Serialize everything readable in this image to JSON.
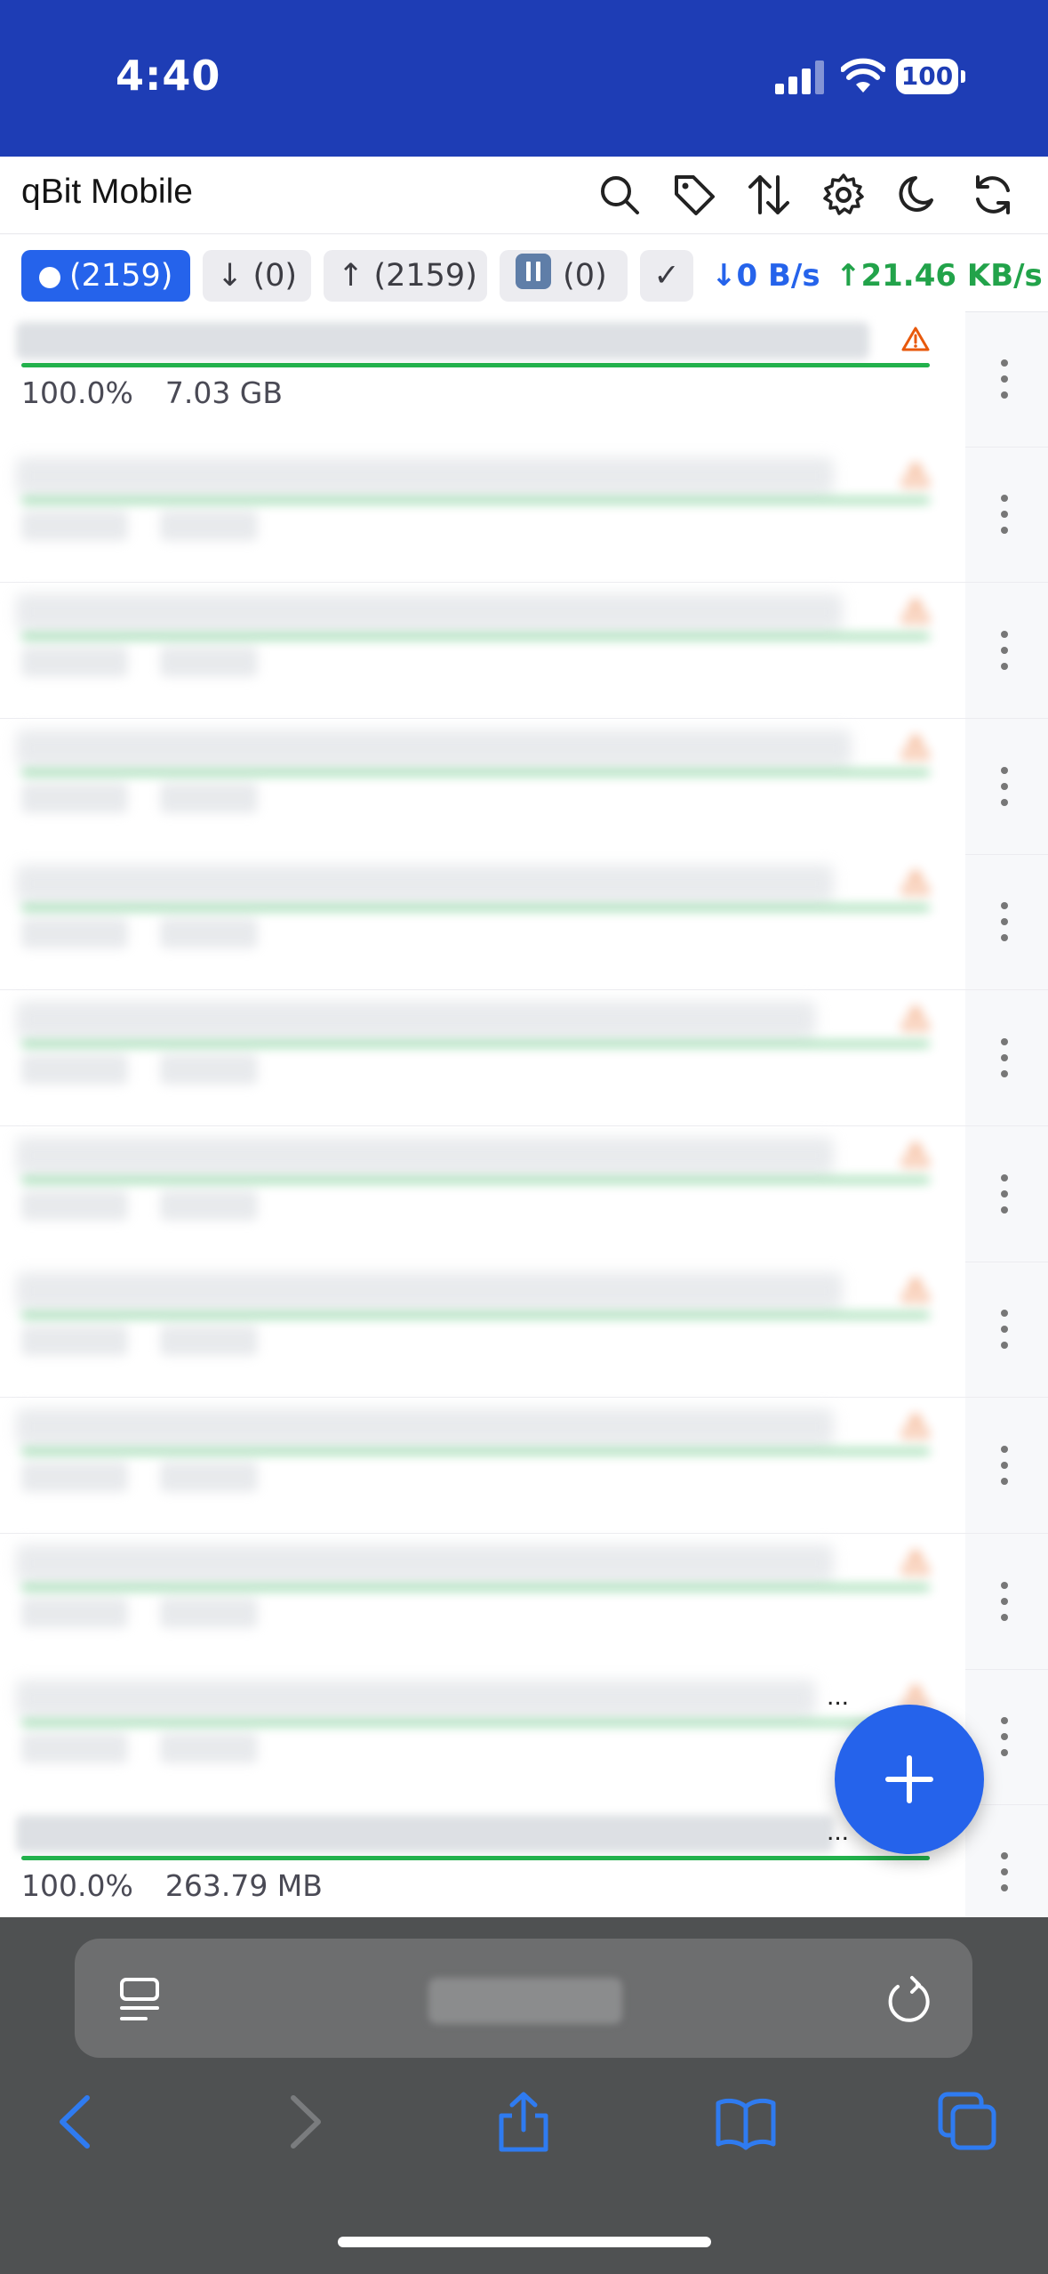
{
  "status_bar": {
    "time": "4:40",
    "battery": "100"
  },
  "app": {
    "title": "qBit Mobile"
  },
  "toolbar_icons": [
    "search-icon",
    "tag-icon",
    "sort-icon",
    "gear-icon",
    "moon-icon",
    "refresh-icon"
  ],
  "filters": {
    "all": "(2159)",
    "downloading": "(0)",
    "seeding": "(2159)",
    "paused": "(0)",
    "completed_icon": "checkmark-icon"
  },
  "speeds": {
    "download": "↓0 B/s",
    "upload": "↑21.46 KB/s",
    "download_color": "#2563eb",
    "upload_color": "#22a34a"
  },
  "torrents": [
    {
      "progress": "100.0%",
      "size": "7.03 GB",
      "progress_fraction": 1.0,
      "warning": true
    },
    {
      "blurred": true
    },
    {
      "blurred": true
    },
    {
      "blurred": true
    },
    {
      "blurred": true
    },
    {
      "blurred": true
    },
    {
      "blurred": true
    },
    {
      "blurred": true
    },
    {
      "blurred": true
    },
    {
      "blurred": true
    },
    {
      "blurred": true,
      "ellipsis": "..."
    },
    {
      "progress": "100.0%",
      "size": "263.79 MB",
      "progress_fraction": 1.0,
      "ellipsis": "..."
    }
  ],
  "colors": {
    "accent": "#2563eb",
    "header": "#1e3db5",
    "progress": "#22b14c",
    "warning": "#e8590c"
  }
}
